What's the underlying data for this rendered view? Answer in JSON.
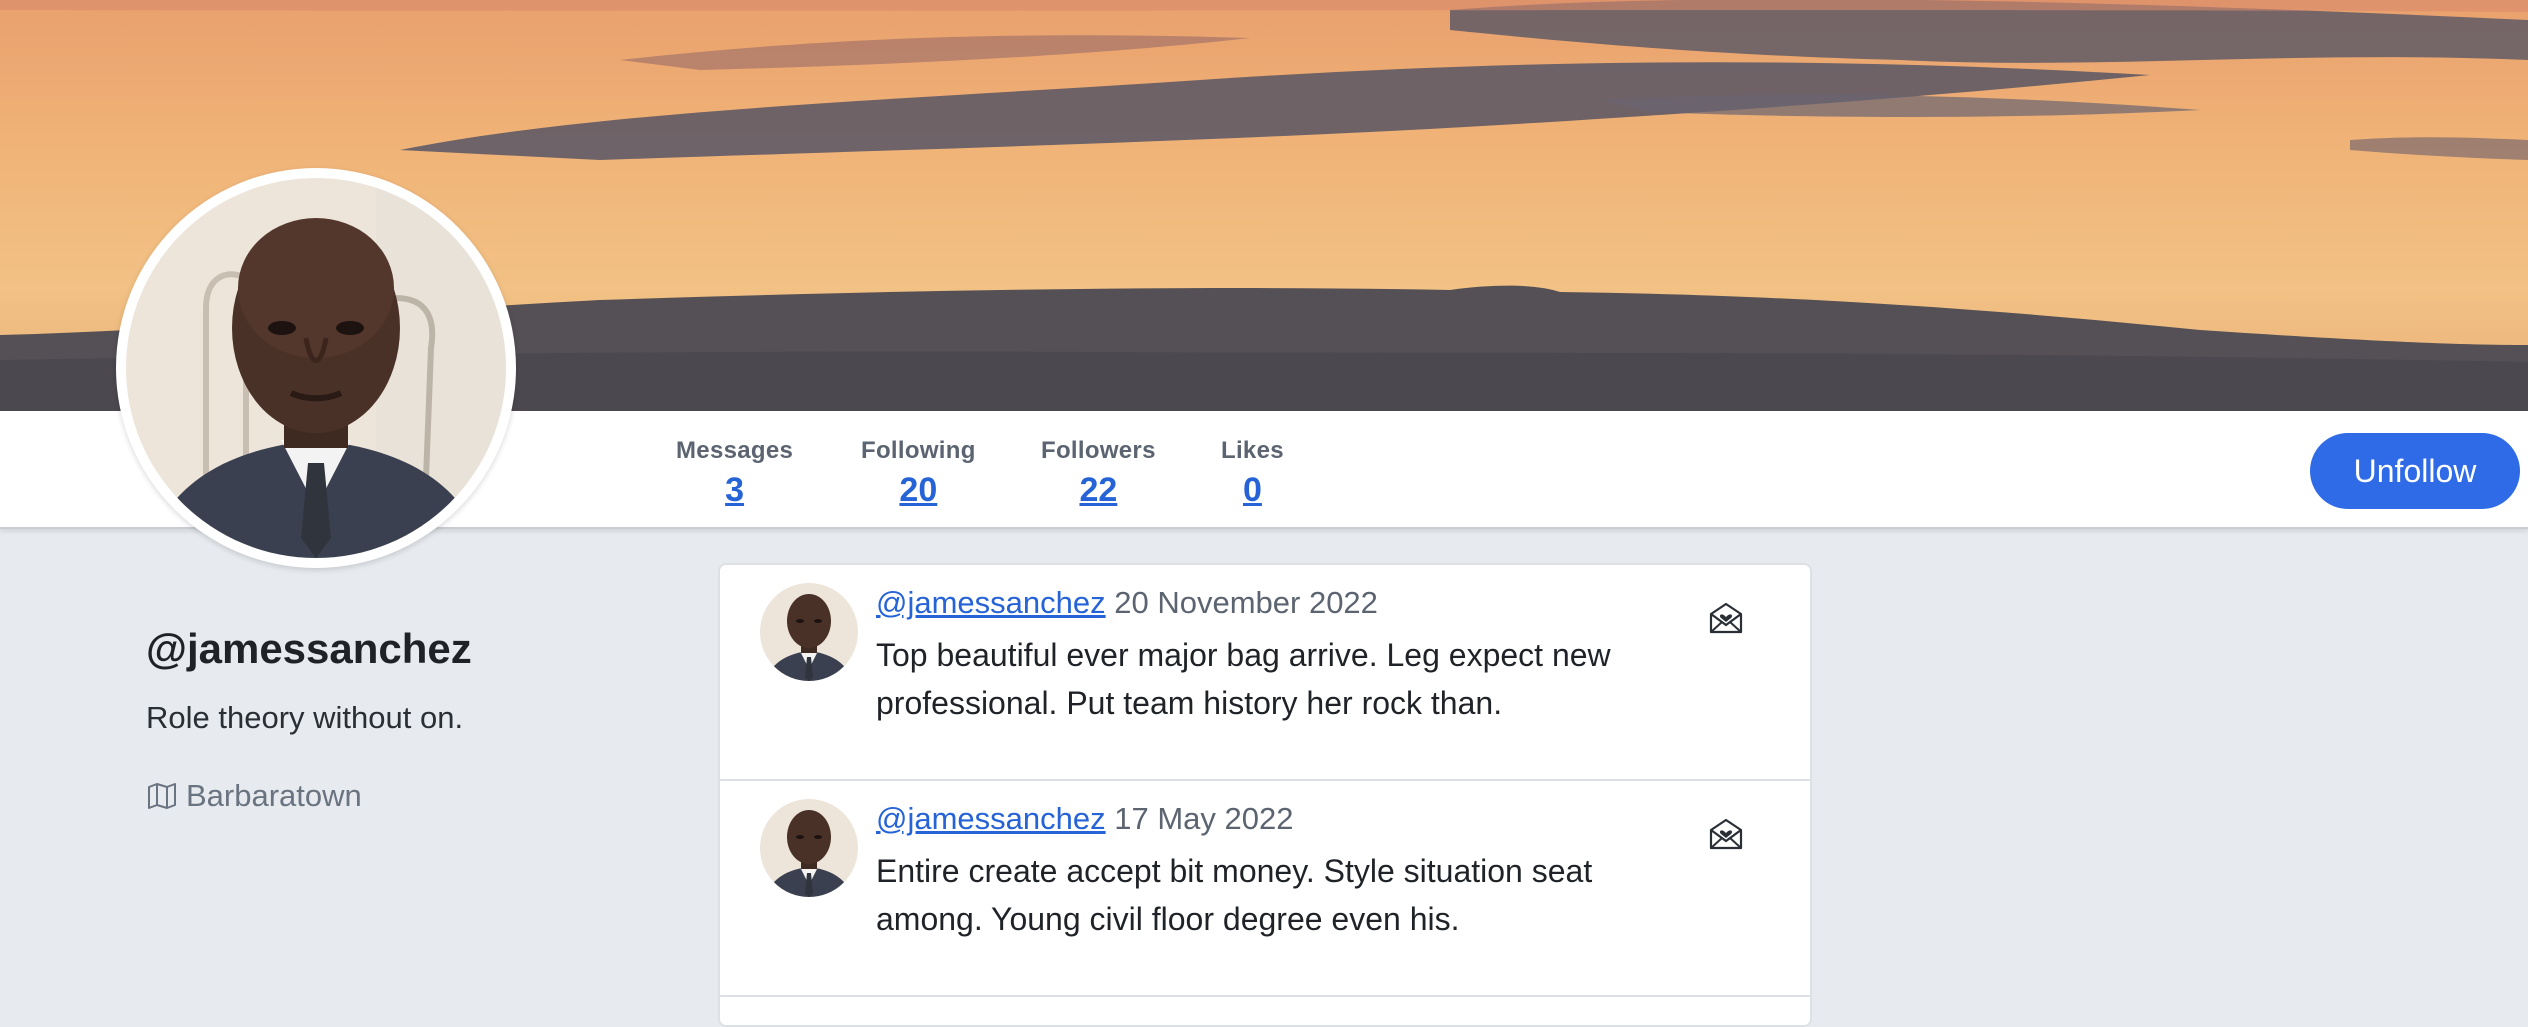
{
  "profile": {
    "handle": "@jamessanchez",
    "bio": "Role theory without on.",
    "location": "Barbaratown"
  },
  "stats": {
    "messages": {
      "label": "Messages",
      "value": "3"
    },
    "following": {
      "label": "Following",
      "value": "20"
    },
    "followers": {
      "label": "Followers",
      "value": "22"
    },
    "likes": {
      "label": "Likes",
      "value": "0"
    }
  },
  "actions": {
    "unfollow_label": "Unfollow"
  },
  "feed": {
    "posts": [
      {
        "user": "@jamessanchez",
        "date": "20 November 2022",
        "text": "Top beautiful ever major bag arrive. Leg expect new professional. Put team history her rock than."
      },
      {
        "user": "@jamessanchez",
        "date": "17 May 2022",
        "text": "Entire create accept bit money. Style situation seat among. Young civil floor degree even his."
      }
    ]
  },
  "icons": {
    "location": "map-icon",
    "message": "envelope-heart-icon"
  },
  "colors": {
    "accent": "#2f6be7",
    "link": "#2563d6",
    "page_bg": "#e7ebef"
  }
}
